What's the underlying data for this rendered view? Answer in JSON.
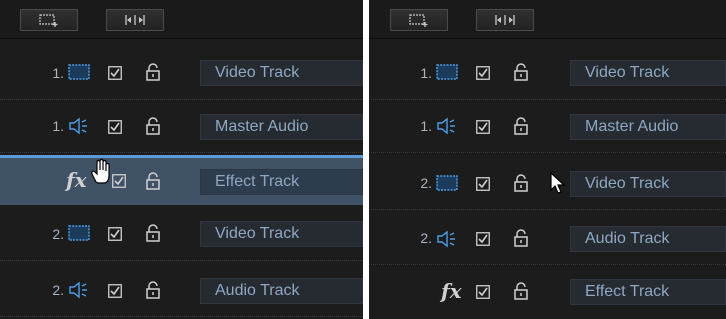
{
  "left_panel": {
    "toolbar": {
      "add_track_icon": "add-track-icon",
      "fit_icon": "fit-timeline-icon"
    },
    "rows": [
      {
        "number": "1.",
        "type_icon": "video-track-icon",
        "label": "Video Track"
      },
      {
        "number": "1.",
        "type_icon": "audio-track-icon",
        "label": "Master Audio"
      },
      {
        "number": "",
        "type_icon": "fx-icon",
        "label": "Effect Track",
        "state": "dragging"
      },
      {
        "number": "2.",
        "type_icon": "video-track-icon",
        "label": "Video Track"
      },
      {
        "number": "2.",
        "type_icon": "audio-track-icon",
        "label": "Audio Track"
      }
    ]
  },
  "right_panel": {
    "toolbar": {
      "add_track_icon": "add-track-icon",
      "fit_icon": "fit-timeline-icon"
    },
    "rows": [
      {
        "number": "1.",
        "type_icon": "video-track-icon",
        "label": "Video Track"
      },
      {
        "number": "1.",
        "type_icon": "audio-track-icon",
        "label": "Master Audio"
      },
      {
        "number": "2.",
        "type_icon": "video-track-icon",
        "label": "Video Track"
      },
      {
        "number": "2.",
        "type_icon": "audio-track-icon",
        "label": "Audio Track"
      },
      {
        "number": "",
        "type_icon": "fx-icon",
        "label": "Effect Track"
      }
    ]
  },
  "fx_symbol": "fx",
  "colors": {
    "panel_bg": "#1c1c1c",
    "icon_blue": "#4a9fe6",
    "label_text": "#8fa7c2",
    "drag_highlight": "#3f5266",
    "drop_line": "#5b9ad6"
  }
}
